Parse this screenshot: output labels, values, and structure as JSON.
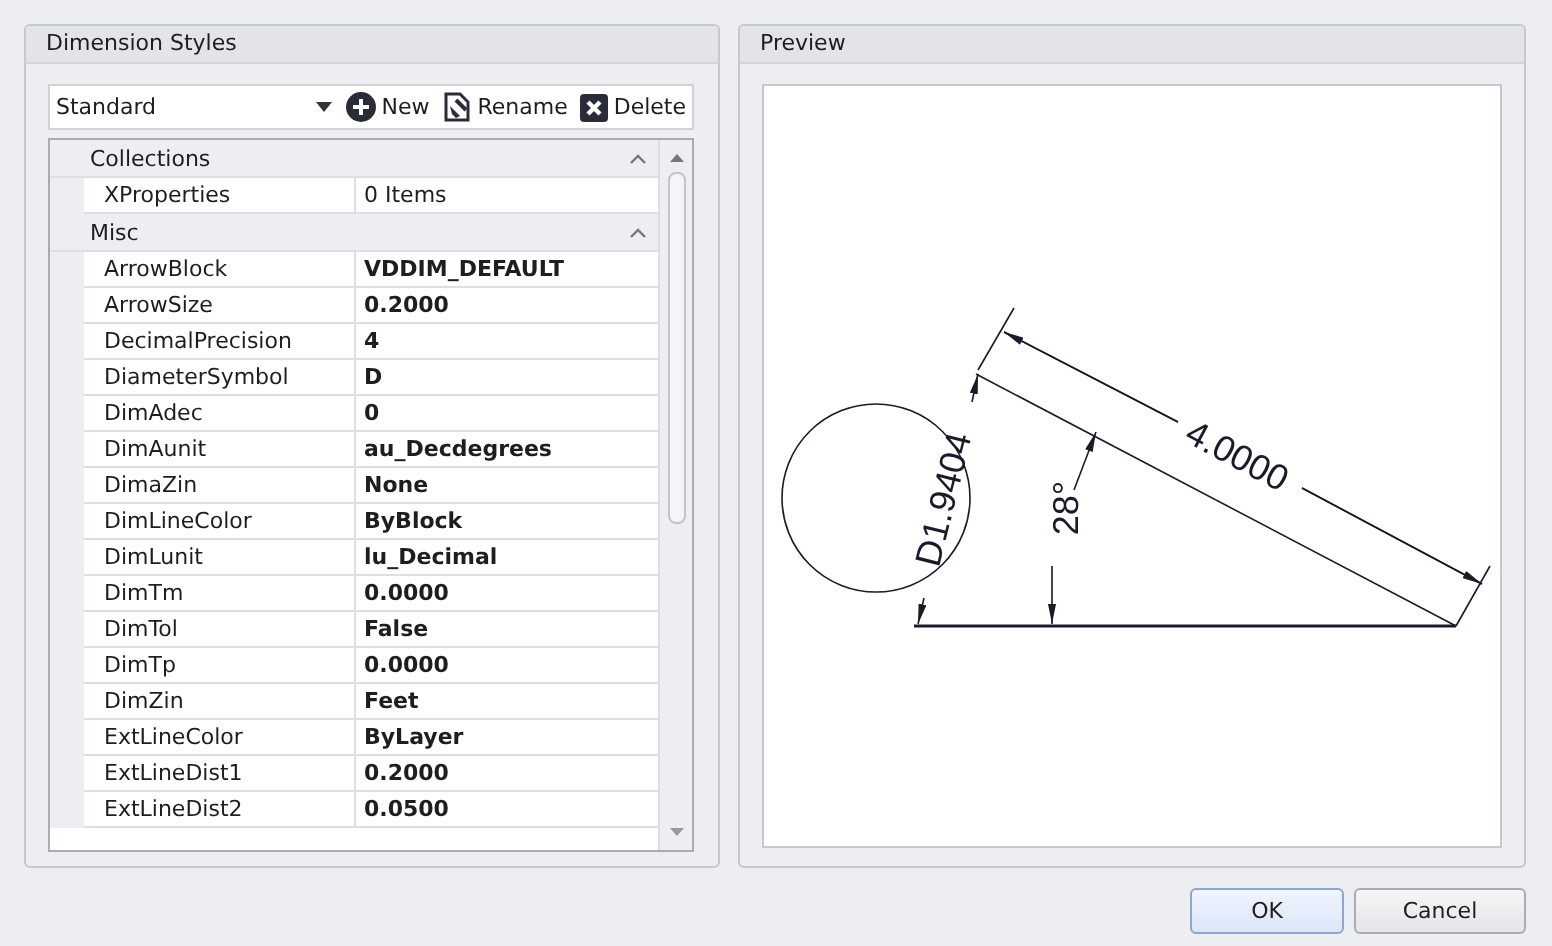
{
  "styles_panel": {
    "title": "Dimension Styles",
    "style_select": {
      "value": "Standard"
    },
    "buttons": [
      {
        "kind": "new",
        "label": "New"
      },
      {
        "kind": "rename",
        "label": "Rename"
      },
      {
        "kind": "delete",
        "label": "Delete"
      }
    ],
    "categories": [
      {
        "name": "Collections",
        "expanded": true,
        "properties": [
          {
            "name": "XProperties",
            "value": "0 Items",
            "modified": false
          }
        ]
      },
      {
        "name": "Misc",
        "expanded": true,
        "properties": [
          {
            "name": "ArrowBlock",
            "value": "VDDIM_DEFAULT",
            "modified": true
          },
          {
            "name": "ArrowSize",
            "value": "0.2000",
            "modified": true
          },
          {
            "name": "DecimalPrecision",
            "value": "4",
            "modified": true
          },
          {
            "name": "DiameterSymbol",
            "value": "D",
            "modified": true
          },
          {
            "name": "DimAdec",
            "value": "0",
            "modified": true
          },
          {
            "name": "DimAunit",
            "value": "au_Decdegrees",
            "modified": true
          },
          {
            "name": "DimaZin",
            "value": "None",
            "modified": true
          },
          {
            "name": "DimLineColor",
            "value": "ByBlock",
            "modified": true
          },
          {
            "name": "DimLunit",
            "value": "lu_Decimal",
            "modified": true
          },
          {
            "name": "DimTm",
            "value": "0.0000",
            "modified": true
          },
          {
            "name": "DimTol",
            "value": "False",
            "modified": true
          },
          {
            "name": "DimTp",
            "value": "0.0000",
            "modified": true
          },
          {
            "name": "DimZin",
            "value": "Feet",
            "modified": true
          },
          {
            "name": "ExtLineColor",
            "value": "ByLayer",
            "modified": true
          },
          {
            "name": "ExtLineDist1",
            "value": "0.2000",
            "modified": true
          },
          {
            "name": "ExtLineDist2",
            "value": "0.0500",
            "modified": true
          }
        ]
      }
    ]
  },
  "preview_panel": {
    "title": "Preview",
    "diameter_label": "D1.9404",
    "angle_label": "28°",
    "length_label": "4.0000"
  },
  "dialog_buttons": [
    {
      "label": "OK",
      "default": true
    },
    {
      "label": "Cancel",
      "default": false
    }
  ]
}
